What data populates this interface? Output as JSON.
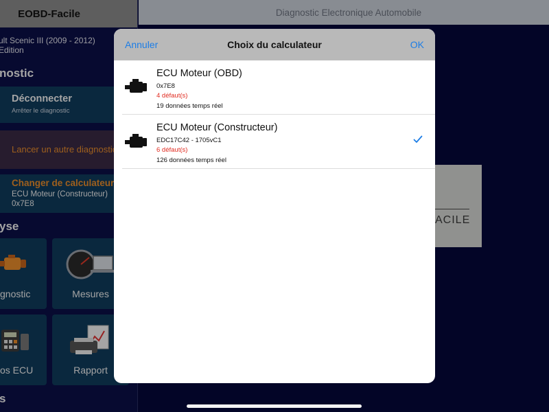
{
  "app": {
    "title": "EOBD-Facile",
    "subtitle": "Diagnostic Electronique Automobile",
    "vehicle_line1": "ult Scenic III (2009 - 2012)",
    "vehicle_line2": "Edition",
    "logo_word": "ACILE"
  },
  "sidebar": {
    "section_diagnostic": "nostic",
    "disconnect_title": "Déconnecter",
    "disconnect_sub": "Arrêter le diagnostic",
    "other_diag": "Lancer un autre diagnostic",
    "change_ecu_title": "Changer de calculateur",
    "change_ecu_name": "ECU Moteur (Constructeur)",
    "change_ecu_addr": "0x7E8",
    "section_analyse": "yse",
    "tiles": [
      {
        "label": "gnostic",
        "icon": "engine-icon"
      },
      {
        "label": "Mesures",
        "icon": "gauge-icon"
      },
      {
        "label": "os ECU",
        "icon": "calculator-icon"
      },
      {
        "label": "Rapport",
        "icon": "printer-icon"
      }
    ],
    "section_bottom": "s"
  },
  "modal": {
    "cancel_label": "Annuler",
    "title": "Choix du calculateur",
    "ok_label": "OK",
    "ecus": [
      {
        "name": "ECU Moteur (OBD)",
        "code": "0x7E8",
        "faults": "4 défaut(s)",
        "live_data": "19 données temps réel",
        "selected": false
      },
      {
        "name": "ECU Moteur (Constructeur)",
        "code": "EDC17C42 - 1705vC1",
        "faults": "6 défaut(s)",
        "live_data": "126 données temps réel",
        "selected": true
      }
    ]
  },
  "colors": {
    "accent_blue": "#1c7de6",
    "fault_red": "#e02a1f",
    "orange_text": "#e98d2c",
    "sidebar_bg": "#0b1047"
  }
}
